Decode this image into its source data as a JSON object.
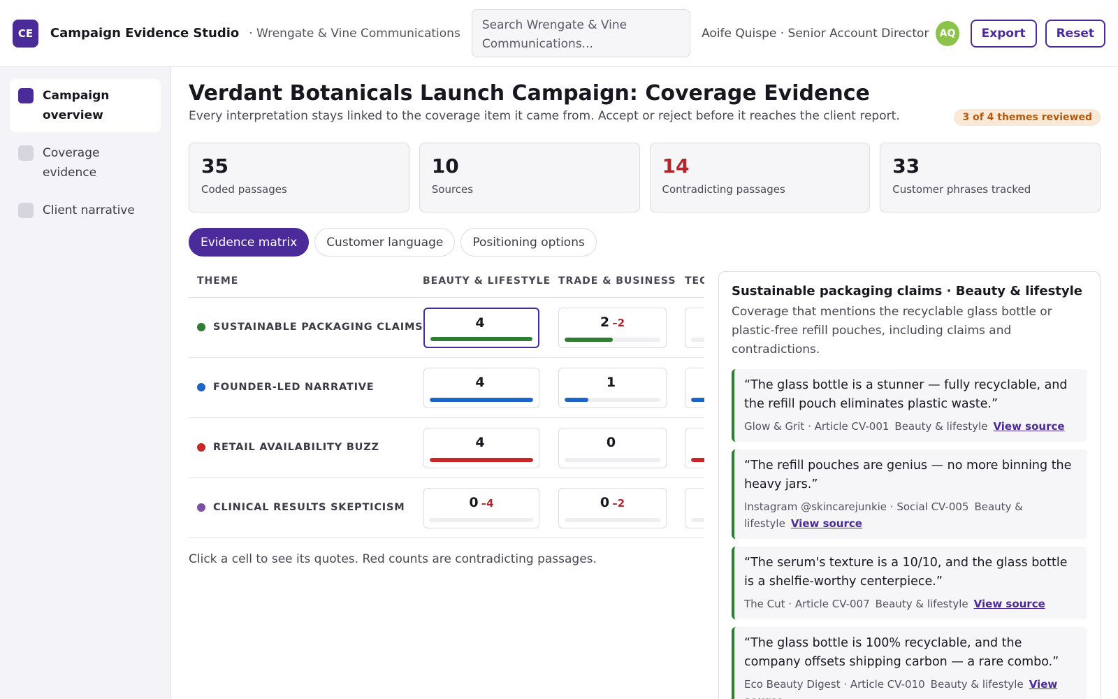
{
  "header": {
    "logo_text": "CE",
    "app_title": "Campaign Evidence Studio",
    "org": "· Wrengate & Vine Communications",
    "search_placeholder": "Search Wrengate & Vine Communications...",
    "user": "Aoife Quispe · Senior Account Director",
    "avatar_initials": "AQ",
    "export_label": "Export",
    "reset_label": "Reset"
  },
  "sidebar": {
    "items": [
      {
        "label": "Campaign overview",
        "active": true
      },
      {
        "label": "Coverage evidence",
        "active": false
      },
      {
        "label": "Client narrative",
        "active": false
      }
    ]
  },
  "page": {
    "title": "Verdant Botanicals Launch Campaign: Coverage Evidence",
    "subtitle": "Every interpretation stays linked to the coverage item it came from. Accept or reject before it reaches the client report.",
    "review_badge": "3 of 4 themes reviewed"
  },
  "stats": [
    {
      "value": "35",
      "label": "Coded passages"
    },
    {
      "value": "10",
      "label": "Sources"
    },
    {
      "value": "14",
      "label": "Contradicting passages"
    },
    {
      "value": "33",
      "label": "Customer phrases tracked"
    }
  ],
  "tabs": [
    {
      "label": "Evidence matrix",
      "active": true
    },
    {
      "label": "Customer language",
      "active": false
    },
    {
      "label": "Positioning options",
      "active": false
    }
  ],
  "matrix": {
    "headers": {
      "theme": "THEME",
      "col1": "BEAUTY & LIFESTYLE",
      "col2": "TRADE & BUSINESS",
      "col3": "TEC"
    },
    "rows": [
      {
        "theme": "SUSTAINABLE PACKAGING CLAIMS",
        "color": "#2e7d32",
        "c1": {
          "count": "4",
          "neg": "",
          "fill": 1.0
        },
        "c2": {
          "count": "2",
          "neg": "–2",
          "fill": 0.5
        },
        "c3": {
          "fill": 0.0
        }
      },
      {
        "theme": "FOUNDER-LED NARRATIVE",
        "color": "#1e63c6",
        "c1": {
          "count": "4",
          "neg": "",
          "fill": 1.0
        },
        "c2": {
          "count": "1",
          "neg": "",
          "fill": 0.25
        },
        "c3": {
          "fill": 1.0
        }
      },
      {
        "theme": "RETAIL AVAILABILITY BUZZ",
        "color": "#c62828",
        "c1": {
          "count": "4",
          "neg": "",
          "fill": 1.0
        },
        "c2": {
          "count": "0",
          "neg": "",
          "fill": 0.0
        },
        "c3": {
          "fill": 1.0
        }
      },
      {
        "theme": "CLINICAL RESULTS SKEPTICISM",
        "color": "#7b4fa3",
        "c1": {
          "count": "0",
          "neg": "–4",
          "fill": 0.0
        },
        "c2": {
          "count": "0",
          "neg": "–2",
          "fill": 0.0
        },
        "c3": {
          "fill": 0.0
        }
      }
    ],
    "hint": "Click a cell to see its quotes. Red counts are contradicting passages."
  },
  "panel": {
    "title": "Sustainable packaging claims · Beauty & lifestyle",
    "description": "Coverage that mentions the recyclable glass bottle or plastic-free refill pouches, including claims and contradictions.",
    "quotes": [
      {
        "text": "“The glass bottle is a stunner — fully recyclable, and the refill pouch eliminates plastic waste.”",
        "source": "Glow & Grit · Article CV-001",
        "category": "Beauty & lifestyle",
        "link": "View source"
      },
      {
        "text": "“The refill pouches are genius — no more binning the heavy jars.”",
        "source": "Instagram @skincarejunkie · Social CV-005",
        "category": "Beauty & lifestyle",
        "link": "View source"
      },
      {
        "text": "“The serum's texture is a 10/10, and the glass bottle is a shelfie-worthy centerpiece.”",
        "source": "The Cut · Article CV-007",
        "category": "Beauty & lifestyle",
        "link": "View source"
      },
      {
        "text": "“The glass bottle is 100% recyclable, and the company offsets shipping carbon — a rare combo.”",
        "source": "Eco Beauty Digest · Article CV-010",
        "category": "Beauty & lifestyle",
        "link": "View source"
      }
    ]
  },
  "colors": {
    "accent": "#4b2a99",
    "contradiction": "#b3262e",
    "badge_bg": "#fbe9d7",
    "badge_text": "#b45a10"
  }
}
